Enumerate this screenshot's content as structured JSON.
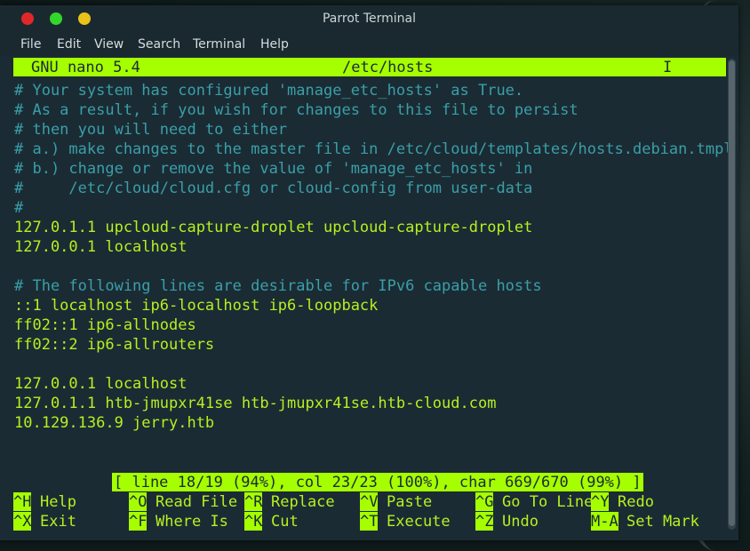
{
  "window": {
    "title": "Parrot Terminal"
  },
  "menu": [
    "File",
    "Edit",
    "View",
    "Search",
    "Terminal",
    "Help"
  ],
  "nano": {
    "app": "GNU nano 5.4",
    "file": "/etc/hosts",
    "flag": "I"
  },
  "lines": [
    {
      "t": "# Your system has configured 'manage_etc_hosts' as True.",
      "c": "comment"
    },
    {
      "t": "# As a result, if you wish for changes to this file to persist",
      "c": "comment"
    },
    {
      "t": "# then you will need to either",
      "c": "comment"
    },
    {
      "t": "# a.) make changes to the master file in /etc/cloud/templates/hosts.debian.tmpl",
      "c": "comment"
    },
    {
      "t": "# b.) change or remove the value of 'manage_etc_hosts' in",
      "c": "comment"
    },
    {
      "t": "#     /etc/cloud/cloud.cfg or cloud-config from user-data",
      "c": "comment"
    },
    {
      "t": "#",
      "c": "comment"
    },
    {
      "t": "127.0.1.1 upcloud-capture-droplet upcloud-capture-droplet",
      "c": "text"
    },
    {
      "t": "127.0.0.1 localhost",
      "c": "text"
    },
    {
      "t": "",
      "c": "text"
    },
    {
      "t": "# The following lines are desirable for IPv6 capable hosts",
      "c": "comment"
    },
    {
      "t": "::1 localhost ip6-localhost ip6-loopback",
      "c": "text"
    },
    {
      "t": "ff02::1 ip6-allnodes",
      "c": "text"
    },
    {
      "t": "ff02::2 ip6-allrouters",
      "c": "text"
    },
    {
      "t": "",
      "c": "text"
    },
    {
      "t": "127.0.0.1 localhost",
      "c": "text"
    },
    {
      "t": "127.0.1.1 htb-jmupxr41se htb-jmupxr41se.htb-cloud.com",
      "c": "text"
    },
    {
      "t": "10.129.136.9 jerry.htb",
      "c": "text"
    }
  ],
  "status": "[ line 18/19 (94%), col 23/23 (100%), char 669/670 (99%) ]",
  "shortcuts_row1": [
    {
      "key": "^H",
      "label": "Help"
    },
    {
      "key": "^O",
      "label": "Read File"
    },
    {
      "key": "^R",
      "label": "Replace"
    },
    {
      "key": "^V",
      "label": "Paste"
    },
    {
      "key": "^G",
      "label": "Go To Line"
    },
    {
      "key": "^Y",
      "label": "Redo"
    }
  ],
  "shortcuts_row2": [
    {
      "key": "^X",
      "label": "Exit"
    },
    {
      "key": "^F",
      "label": "Where Is"
    },
    {
      "key": "^K",
      "label": "Cut"
    },
    {
      "key": "^T",
      "label": "Execute"
    },
    {
      "key": "^Z",
      "label": "Undo"
    },
    {
      "key": "M-A",
      "label": "Set Mark"
    }
  ]
}
